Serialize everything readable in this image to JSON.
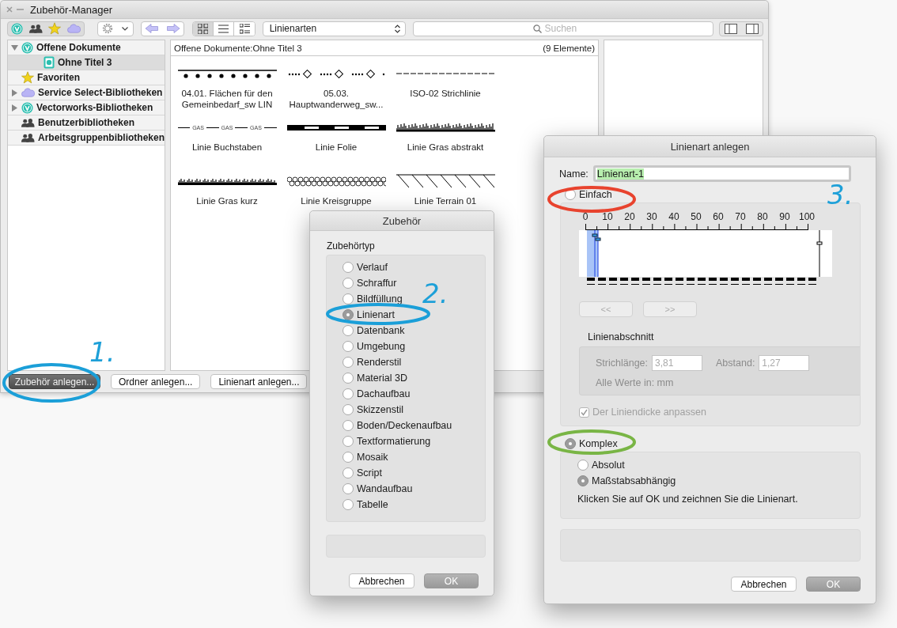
{
  "window": {
    "title": "Zubehör-Manager"
  },
  "toolbar": {
    "view_modes": [
      {
        "selected": true
      },
      {
        "selected": false
      },
      {
        "selected": false
      }
    ],
    "library_select": {
      "value": "Linienarten"
    },
    "search": {
      "placeholder": "Suchen"
    }
  },
  "sidebar": {
    "items": [
      {
        "label": "Offene Dokumente",
        "kind": "library",
        "expanded": true,
        "selected": false,
        "children": [
          {
            "label": "Ohne Titel 3",
            "kind": "document",
            "selected": true
          }
        ]
      },
      {
        "label": "Favoriten",
        "kind": "favorites",
        "selected": false
      },
      {
        "label": "Service Select-Bibliotheken",
        "kind": "cloud",
        "expanded": false,
        "selected": false
      },
      {
        "label": "Vectorworks-Bibliotheken",
        "kind": "library",
        "expanded": false,
        "selected": false
      },
      {
        "label": "Benutzerbibliotheken",
        "kind": "users",
        "selected": false
      },
      {
        "label": "Arbeitsgruppenbibliotheken",
        "kind": "users",
        "selected": false
      }
    ]
  },
  "content": {
    "path": "Offene Dokumente:Ohne Titel 3",
    "count": "(9 Elemente)",
    "items": [
      {
        "name": "04.01. Flächen für den Gemeinbedarf_sw LIN",
        "kind": "dots"
      },
      {
        "name": "05.03. Hauptwanderweg_sw...",
        "kind": "diamonds"
      },
      {
        "name": "ISO-02 Strichlinie",
        "kind": "dashes"
      },
      {
        "name": "Linie Buchstaben",
        "kind": "letters",
        "marks": [
          "GAS",
          "GAS",
          "GAS"
        ]
      },
      {
        "name": "Linie Folie",
        "kind": "foil"
      },
      {
        "name": "Linie Gras abstrakt",
        "kind": "grass"
      },
      {
        "name": "Linie Gras kurz",
        "kind": "grass_short"
      },
      {
        "name": "Linie Kreisgruppe",
        "kind": "circles"
      },
      {
        "name": "Linie Terrain 01",
        "kind": "terrain"
      }
    ]
  },
  "buttons": [
    {
      "label": "Zubehör anlegen...",
      "pressed": true
    },
    {
      "label": "Ordner anlegen...",
      "pressed": false
    },
    {
      "label": "Linienart anlegen...",
      "pressed": false
    }
  ],
  "accessory_dialog": {
    "title": "Zubehör",
    "group_label": "Zubehörtyp",
    "options": [
      {
        "label": "Verlauf",
        "selected": false
      },
      {
        "label": "Schraffur",
        "selected": false
      },
      {
        "label": "Bildfüllung",
        "selected": false
      },
      {
        "label": "Linienart",
        "selected": true
      },
      {
        "label": "Datenbank",
        "selected": false
      },
      {
        "label": "Umgebung",
        "selected": false
      },
      {
        "label": "Renderstil",
        "selected": false
      },
      {
        "label": "Material 3D",
        "selected": false
      },
      {
        "label": "Dachaufbau",
        "selected": false
      },
      {
        "label": "Skizzenstil",
        "selected": false
      },
      {
        "label": "Boden/Deckenaufbau",
        "selected": false
      },
      {
        "label": "Textformatierung",
        "selected": false
      },
      {
        "label": "Mosaik",
        "selected": false
      },
      {
        "label": "Script",
        "selected": false
      },
      {
        "label": "Wandaufbau",
        "selected": false
      },
      {
        "label": "Tabelle",
        "selected": false
      }
    ],
    "buttons": [
      {
        "label": "Abbrechen",
        "kind": "normal"
      },
      {
        "label": "OK",
        "kind": "default"
      }
    ]
  },
  "linestyle_dialog": {
    "title": "Linienart anlegen",
    "name_label": "Name:",
    "name_value": "Linienart-1",
    "name_selected": true,
    "simple": {
      "label": "Einfach",
      "selected": false
    },
    "ruler_labels": [
      "0",
      "10",
      "20",
      "30",
      "40",
      "50",
      "60",
      "70",
      "80",
      "90",
      "100"
    ],
    "nav_buttons": [
      {
        "label": "<<",
        "disabled": true
      },
      {
        "label": ">>",
        "disabled": true
      }
    ],
    "segment": {
      "label": "Linienabschnitt",
      "disabled": true,
      "fields": [
        {
          "label": "Strichlänge:",
          "value": "3,81"
        },
        {
          "label": "Abstand:",
          "value": "1,27"
        }
      ],
      "units": "Alle Werte in: mm"
    },
    "thickness": {
      "label": "Der Liniendicke anpassen",
      "checked": true,
      "disabled": true
    },
    "complex": {
      "label": "Komplex",
      "selected": true
    },
    "scale_options": [
      {
        "label": "Absolut",
        "selected": false
      },
      {
        "label": "Maßstabsabhängig",
        "selected": true
      }
    ],
    "hint": "Klicken Sie auf OK und zeichnen Sie die Linienart.",
    "buttons": [
      {
        "label": "Abbrechen",
        "kind": "normal"
      },
      {
        "label": "OK",
        "kind": "default"
      }
    ]
  },
  "annotations": [
    {
      "label": "1.",
      "color": "#1ea0d8"
    },
    {
      "label": "2.",
      "color": "#1ea0d8"
    },
    {
      "label": "3.",
      "color": "#1ea0d8"
    }
  ],
  "highlights": [
    {
      "color": "#1b9fd8"
    },
    {
      "color": "#1b9fd8"
    },
    {
      "color": "#e8432e"
    },
    {
      "color": "#79b545"
    }
  ]
}
